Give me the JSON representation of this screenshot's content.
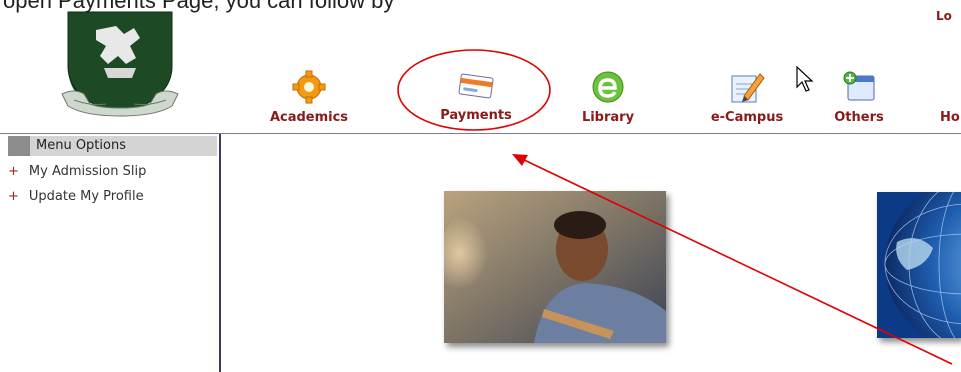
{
  "caption": "open Payments Page, you can follow by",
  "header": {
    "logout_label": "Lo"
  },
  "nav": [
    {
      "key": "academics",
      "label": "Academics"
    },
    {
      "key": "payments",
      "label": "Payments"
    },
    {
      "key": "library",
      "label": "Library"
    },
    {
      "key": "ecampus",
      "label": "e-Campus"
    },
    {
      "key": "others",
      "label": "Others"
    },
    {
      "key": "home",
      "label": "Ho"
    }
  ],
  "sidebar": {
    "header": "Menu Options",
    "items": [
      {
        "label": "My Admission Slip",
        "bullet": "+"
      },
      {
        "label": "Update My Profile",
        "bullet": "+"
      }
    ]
  },
  "colors": {
    "nav_text": "#8a1a1a",
    "crest": "#1d4a24",
    "annotation": "#e00000"
  }
}
